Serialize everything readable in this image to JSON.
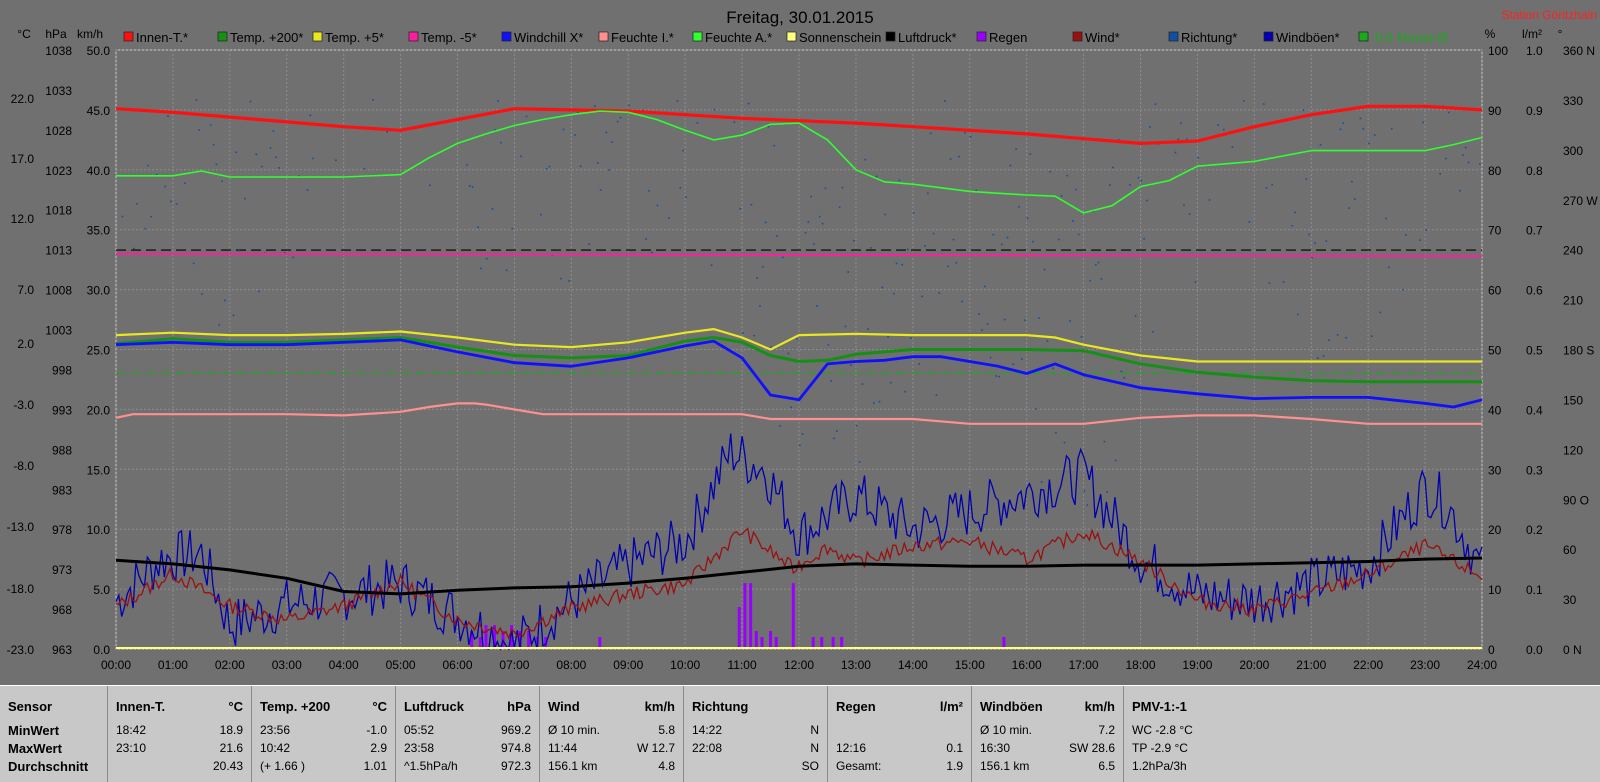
{
  "window": {
    "title": "Freitag, 30.01.2015",
    "station": "Station Göritzhain"
  },
  "legend": [
    {
      "label": "Innen-T.*",
      "color": "#ff1010"
    },
    {
      "label": "Temp. +200*",
      "color": "#159015"
    },
    {
      "label": "Temp. +5*",
      "color": "#e8e820"
    },
    {
      "label": "Temp. -5*",
      "color": "#ff1ea0"
    },
    {
      "label": "Windchill X*",
      "color": "#1010ff"
    },
    {
      "label": "Feuchte I.*",
      "color": "#ff9090"
    },
    {
      "label": "Feuchte A.*",
      "color": "#30ff30"
    },
    {
      "label": "Sonnenschein",
      "color": "#ffff80"
    },
    {
      "label": "Luftdruck*",
      "color": "#000000"
    },
    {
      "label": "Regen",
      "color": "#9a00ff"
    },
    {
      "label": "Wind*",
      "color": "#9a1010"
    },
    {
      "label": "Richtung*",
      "color": "#1050a0"
    },
    {
      "label": "Windböen*",
      "color": "#0000b0"
    },
    {
      "label": "-0.6 Monat-Ø",
      "color": "#1ba81b"
    }
  ],
  "axis_headers": {
    "temp": "°C",
    "hpa": "hPa",
    "kmh": "km/h",
    "pct": "%",
    "rain": "l/m²",
    "dir": "°"
  },
  "chart_data": {
    "type": "line",
    "x_ticks": [
      "00:00",
      "01:00",
      "02:00",
      "03:00",
      "04:00",
      "05:00",
      "06:00",
      "07:00",
      "08:00",
      "09:00",
      "10:00",
      "11:00",
      "12:00",
      "13:00",
      "14:00",
      "15:00",
      "16:00",
      "17:00",
      "18:00",
      "19:00",
      "20:00",
      "21:00",
      "22:00",
      "23:00",
      "24:00"
    ],
    "y_axes": {
      "temp_c": [
        "22.0",
        "17.0",
        "12.0",
        "7.0",
        "2.0",
        "-3.0",
        "-8.0",
        "-13.0",
        "-18.0",
        "-23.0"
      ],
      "pressure_hpa": [
        "1038",
        "1033",
        "1028",
        "1023",
        "1018",
        "1013",
        "1008",
        "1003",
        "998",
        "993",
        "988",
        "983",
        "978",
        "973",
        "968",
        "963"
      ],
      "wind_kmh": [
        "50.0",
        "45.0",
        "40.0",
        "35.0",
        "30.0",
        "25.0",
        "20.0",
        "15.0",
        "10.0",
        "5.0",
        "0.0"
      ],
      "humidity_pct": [
        "100",
        "90",
        "80",
        "70",
        "60",
        "50",
        "40",
        "30",
        "20",
        "10",
        "0"
      ],
      "rain_lm2": [
        "1.0",
        "0.9",
        "0.8",
        "0.7",
        "0.6",
        "0.5",
        "0.4",
        "0.3",
        "0.2",
        "0.1",
        "0.0"
      ],
      "direction_deg": [
        "360 N",
        "330",
        "300",
        "270 W",
        "240",
        "210",
        "180 S",
        "150",
        "120",
        "90 O",
        "60",
        "30",
        "0 N"
      ]
    },
    "x_range_h": [
      0,
      24
    ],
    "wind_range_kmh": [
      0,
      50
    ],
    "series": [
      {
        "name": "Innen-T.*",
        "axis": "wind",
        "x": [
          0,
          1,
          2,
          3,
          4,
          5,
          6,
          7,
          8,
          9,
          10,
          11,
          12,
          13,
          14,
          15,
          16,
          17,
          18,
          19,
          20,
          21,
          22,
          23,
          24
        ],
        "y": [
          45.1,
          44.8,
          44.4,
          44.0,
          43.6,
          43.3,
          44.2,
          45.1,
          45.0,
          44.9,
          44.6,
          44.3,
          44.1,
          43.9,
          43.6,
          43.3,
          43.0,
          42.6,
          42.2,
          42.4,
          43.6,
          44.6,
          45.3,
          45.3,
          45.0
        ]
      },
      {
        "name": "Feuchte A.*",
        "axis": "wind",
        "x": [
          0,
          1,
          1.5,
          2,
          3,
          4,
          5,
          5.5,
          6,
          6.5,
          7,
          7.5,
          8,
          8.5,
          9,
          9.5,
          10,
          10.5,
          11,
          11.5,
          12,
          12.5,
          13,
          13.5,
          14,
          15,
          16,
          16.5,
          17,
          17.5,
          18,
          18.5,
          19,
          20,
          21,
          22,
          23,
          23.5,
          24
        ],
        "y": [
          39.5,
          39.5,
          39.9,
          39.4,
          39.4,
          39.4,
          39.6,
          41.0,
          42.2,
          43.0,
          43.7,
          44.2,
          44.6,
          44.9,
          44.8,
          44.2,
          43.3,
          42.5,
          42.9,
          43.8,
          43.9,
          42.5,
          40.0,
          39.0,
          38.8,
          38.2,
          37.9,
          37.8,
          36.4,
          37.0,
          38.6,
          39.1,
          40.3,
          40.7,
          41.6,
          41.6,
          41.6,
          42.1,
          42.7
        ]
      },
      {
        "name": "Temp. +5*",
        "axis": "wind",
        "x": [
          0,
          1,
          2,
          3,
          4,
          5,
          6,
          7,
          8,
          9,
          10,
          10.5,
          11,
          11.5,
          12,
          13,
          14,
          15,
          16,
          16.5,
          17,
          18,
          19,
          20,
          21,
          22,
          23,
          24
        ],
        "y": [
          26.2,
          26.4,
          26.2,
          26.2,
          26.3,
          26.5,
          26.0,
          25.4,
          25.2,
          25.6,
          26.4,
          26.7,
          26.0,
          25.0,
          26.2,
          26.3,
          26.2,
          26.2,
          26.2,
          26.0,
          25.4,
          24.5,
          24.0,
          24.0,
          24.0,
          24.0,
          24.0,
          24.0
        ]
      },
      {
        "name": "Temp. +200*",
        "axis": "wind",
        "x": [
          0,
          1,
          2,
          3,
          4,
          5,
          6,
          7,
          8,
          9,
          10,
          10.5,
          11,
          11.5,
          12,
          12.5,
          13,
          14,
          15,
          16,
          17,
          18,
          19,
          20,
          21,
          22,
          23,
          24
        ],
        "y": [
          25.5,
          25.9,
          25.6,
          25.6,
          25.8,
          26.0,
          25.2,
          24.5,
          24.3,
          24.5,
          25.7,
          26.0,
          25.6,
          24.5,
          24.0,
          24.1,
          24.6,
          25.0,
          25.0,
          25.0,
          24.9,
          23.8,
          23.1,
          22.7,
          22.4,
          22.3,
          22.3,
          22.3
        ]
      },
      {
        "name": "Windchill X*",
        "axis": "wind",
        "x": [
          0,
          1,
          2,
          3,
          4,
          5,
          6,
          7,
          8,
          9,
          10,
          10.5,
          11,
          11.5,
          12,
          12.5,
          13,
          13.5,
          14,
          14.5,
          15,
          15.5,
          16,
          16.5,
          17,
          18,
          19,
          20,
          21,
          22,
          23,
          23.5,
          24
        ],
        "y": [
          25.4,
          25.6,
          25.4,
          25.4,
          25.6,
          25.8,
          24.8,
          23.9,
          23.6,
          24.3,
          25.3,
          25.7,
          24.3,
          21.2,
          20.8,
          23.8,
          24.0,
          24.1,
          24.4,
          24.4,
          24.0,
          23.6,
          23.0,
          23.8,
          22.9,
          21.8,
          21.3,
          20.9,
          21.0,
          21.0,
          20.5,
          20.2,
          20.8
        ]
      },
      {
        "name": "Feuchte I.*",
        "axis": "wind",
        "x": [
          0,
          0.3,
          1,
          2,
          3,
          4,
          5,
          5.5,
          6,
          6.3,
          6.5,
          7,
          7.5,
          8,
          9,
          10,
          11,
          11.5,
          12,
          13,
          14,
          15,
          16,
          17,
          18,
          19,
          20,
          21,
          22,
          23,
          24
        ],
        "y": [
          19.3,
          19.6,
          19.6,
          19.6,
          19.6,
          19.5,
          19.8,
          20.2,
          20.5,
          20.5,
          20.4,
          20.0,
          19.6,
          19.6,
          19.6,
          19.6,
          19.6,
          19.2,
          19.2,
          19.2,
          19.2,
          18.8,
          18.8,
          18.8,
          19.3,
          19.5,
          19.5,
          19.2,
          18.8,
          18.8,
          18.8
        ]
      },
      {
        "name": "Luftdruck*",
        "axis": "wind",
        "x": [
          0,
          1,
          2,
          3,
          4,
          5,
          6,
          7,
          8,
          9,
          10,
          11,
          12,
          13,
          14,
          15,
          16,
          17,
          18,
          19,
          20,
          21,
          22,
          23,
          24
        ],
        "y": [
          7.4,
          7.1,
          6.6,
          5.9,
          4.8,
          4.6,
          4.9,
          5.1,
          5.2,
          5.5,
          5.9,
          6.4,
          6.9,
          7.1,
          7.0,
          6.9,
          6.9,
          7.0,
          7.0,
          7.0,
          7.1,
          7.2,
          7.3,
          7.5,
          7.6
        ]
      },
      {
        "name": "Temp. -5*",
        "axis": "wind",
        "x": [
          0,
          24
        ],
        "y": [
          33.0,
          32.8
        ]
      }
    ],
    "reference_lines": [
      {
        "name": "Luftdruck",
        "value": 33.3,
        "style": "dashed",
        "color": "#000000"
      },
      {
        "name": "-0.6 Monat-Ø",
        "value": 23.0,
        "style": "dashed",
        "color": "#1ba81b"
      }
    ],
    "rain_bars_h": [
      6.25,
      6.4,
      6.5,
      6.65,
      6.8,
      6.95,
      7.1,
      7.25,
      7.4,
      7.55,
      8.5,
      10.95,
      11.05,
      11.15,
      11.25,
      11.35,
      11.5,
      11.6,
      11.9,
      12.25,
      12.4,
      12.6,
      12.75,
      15.6
    ],
    "rain_bars_lm2": [
      0.03,
      0.02,
      0.04,
      0.04,
      0.03,
      0.04,
      0.03,
      0.03,
      0.02,
      0.02,
      0.02,
      0.07,
      0.11,
      0.11,
      0.03,
      0.02,
      0.03,
      0.02,
      0.11,
      0.02,
      0.02,
      0.02,
      0.02,
      0.02
    ]
  },
  "stats": {
    "columns": [
      {
        "header": "Sensor",
        "unit": "",
        "rows": [
          [
            "MinWert",
            ""
          ],
          [
            "MaxWert",
            ""
          ],
          [
            "Durchschnitt",
            ""
          ]
        ]
      },
      {
        "header": "Innen-T.",
        "unit": "°C",
        "rows": [
          [
            "18:42",
            "18.9"
          ],
          [
            "23:10",
            "21.6"
          ],
          [
            "",
            "20.43"
          ]
        ]
      },
      {
        "header": "Temp. +200",
        "unit": "°C",
        "rows": [
          [
            "23:56",
            "-1.0"
          ],
          [
            "10:42",
            "2.9"
          ],
          [
            "(+ 1.66 )",
            "1.01"
          ]
        ]
      },
      {
        "header": "Luftdruck",
        "unit": "hPa",
        "rows": [
          [
            "05:52",
            "969.2"
          ],
          [
            "23:58",
            "974.8"
          ],
          [
            "^1.5hPa/h",
            "972.3"
          ]
        ]
      },
      {
        "header": "Wind",
        "unit": "km/h",
        "rows": [
          [
            "Ø 10 min.",
            "5.8"
          ],
          [
            "11:44",
            "W 12.7"
          ],
          [
            "156.1 km",
            "4.8"
          ]
        ]
      },
      {
        "header": "Richtung",
        "unit": "",
        "rows": [
          [
            "14:22",
            "N"
          ],
          [
            "22:08",
            "N"
          ],
          [
            "",
            "SO"
          ]
        ]
      },
      {
        "header": "Regen",
        "unit": "l/m²",
        "rows": [
          [
            "",
            ""
          ],
          [
            "12:16",
            "0.1"
          ],
          [
            "Gesamt:",
            "1.9"
          ]
        ]
      },
      {
        "header": "Windböen",
        "unit": "km/h",
        "rows": [
          [
            "Ø 10 min.",
            "7.2"
          ],
          [
            "16:30",
            "SW 28.6"
          ],
          [
            "156.1 km",
            "6.5"
          ]
        ]
      },
      {
        "header": "PMV-1:-1",
        "unit": "",
        "rows": [
          [
            "WC -2.8 °C",
            ""
          ],
          [
            "TP -2.9 °C",
            ""
          ],
          [
            "1.2hPa/3h",
            ""
          ]
        ]
      }
    ]
  }
}
